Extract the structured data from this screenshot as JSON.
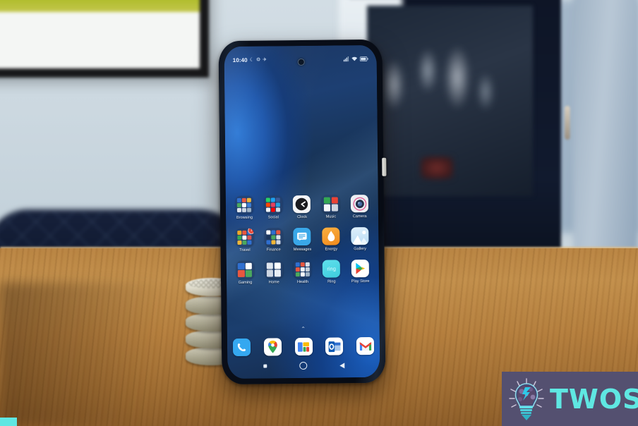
{
  "scene": {
    "description": "Smartphone on wooden table showing Android home screen",
    "colors": {
      "wall": "#cdd9e1",
      "chair": "#101a31",
      "table": "#b47e3d",
      "cabinet": "#111a2e",
      "phone_body": "#0a0f1a",
      "wallpaper_blue": "#1f58ad",
      "watermark_bg": "#545070",
      "watermark_text": "#5fe7e2",
      "badge_red": "#e8422e"
    }
  },
  "phone": {
    "status_bar": {
      "time": "10:40",
      "left_icons": [
        "moon-icon",
        "gear-icon",
        "airplane-icon"
      ],
      "right_icons": [
        "signal-icon",
        "wifi-icon",
        "battery-icon"
      ]
    },
    "camera": "punch-hole-camera",
    "power_button": "power-button",
    "home_screen": {
      "rows": [
        [
          {
            "label": "Browsing",
            "icon": "folder-icon",
            "type": "folder",
            "tiles": [
              "#2f6fd0",
              "#e8573f",
              "#f2b736",
              "#4aa85e",
              "#ffffff",
              "#3d7fd6",
              "#e0e6ee",
              "#cdd6e2",
              "#9fb3c6"
            ],
            "badge": ""
          },
          {
            "label": "Social",
            "icon": "folder-icon",
            "type": "folder",
            "tiles": [
              "#25d366",
              "#1da1f2",
              "#3b5998",
              "#ff4500",
              "#e4405f",
              "#25a0e0",
              "#f0f3f7",
              "#ff0000",
              "#d4dbe4"
            ],
            "badge": ""
          },
          {
            "label": "Clock",
            "icon": "clock-icon",
            "type": "app",
            "color": "#f3f4f6",
            "badge": ""
          },
          {
            "label": "Music",
            "icon": "music-icon",
            "type": "folder",
            "tiles": [
              "#34a853",
              "#ea4335",
              "#f6f7f9",
              "#cfd6e0"
            ],
            "badge": ""
          },
          {
            "label": "Camera",
            "icon": "camera-icon",
            "type": "app",
            "color": "#eceff3",
            "badge": ""
          }
        ],
        [
          {
            "label": "Travel",
            "icon": "folder-icon",
            "type": "folder",
            "tiles": [
              "#f5a623",
              "#e8573f",
              "#2f6fd0",
              "#34a853",
              "#ffffff",
              "#d9534f",
              "#f2b736",
              "#4aa85e",
              "#2f6fd0"
            ],
            "badge": "1"
          },
          {
            "label": "Finance",
            "icon": "folder-icon",
            "type": "folder",
            "tiles": [
              "#ffffff",
              "#2f6fd0",
              "#e8573f",
              "#1b365d",
              "#4aa85e",
              "#e0e6ee",
              "#2f6fd0",
              "#f2b736",
              "#cdd6e2"
            ],
            "badge": ""
          },
          {
            "label": "Messages",
            "icon": "messages-icon",
            "type": "app",
            "color": "#39a7e8",
            "badge": ""
          },
          {
            "label": "Energy",
            "icon": "flame-icon",
            "type": "app",
            "color": "#f59b2c",
            "badge": ""
          },
          {
            "label": "Gallery",
            "icon": "gallery-icon",
            "type": "app",
            "color": "#cfe6f7",
            "badge": ""
          }
        ],
        [
          {
            "label": "Gaming",
            "icon": "folder-icon",
            "type": "folder",
            "tiles": [
              "#2f6fd0",
              "#ffffff",
              "#e8573f",
              "#4aa85e"
            ],
            "badge": ""
          },
          {
            "label": "Home",
            "icon": "folder-icon",
            "type": "folder",
            "tiles": [
              "#dfe6ee",
              "#ffffff",
              "#cdd6e2",
              "#e8eef5"
            ],
            "badge": ""
          },
          {
            "label": "Health",
            "icon": "folder-icon",
            "type": "folder",
            "tiles": [
              "#2f6fd0",
              "#e8573f",
              "#d9dfe7",
              "#e8573f",
              "#f2f5f8",
              "#c7d0da",
              "#4aa85e",
              "#ffffff",
              "#9fb3c6"
            ],
            "badge": ""
          },
          {
            "label": "Ring",
            "icon": "ring-icon",
            "type": "app",
            "color": "#4fd8e8",
            "badge": ""
          },
          {
            "label": "Play Store",
            "icon": "play-store-icon",
            "type": "app",
            "color": "#ffffff",
            "badge": ""
          }
        ]
      ],
      "page_indicator": "up-chevron-icon",
      "dock": [
        {
          "label": "Phone",
          "icon": "phone-icon",
          "color": "#35a8f0"
        },
        {
          "label": "Maps",
          "icon": "maps-icon",
          "color": "#ffffff"
        },
        {
          "label": "News",
          "icon": "news-icon",
          "color": "#ffffff"
        },
        {
          "label": "Outlook",
          "icon": "outlook-icon",
          "color": "#ffffff"
        },
        {
          "label": "Gmail",
          "icon": "gmail-icon",
          "color": "#ffffff"
        }
      ],
      "nav_bar": [
        "recents-square-icon",
        "home-circle-icon",
        "back-triangle-icon"
      ]
    }
  },
  "watermark": {
    "text": "TWOS",
    "logo": "lightbulb-icon"
  },
  "objects": {
    "coasters": "stone-coaster-stack",
    "coaster_count": 5,
    "chair": "navy-quilted-chair",
    "cabinet": "glass-door-cabinet",
    "framed_art": "framed-picture"
  }
}
